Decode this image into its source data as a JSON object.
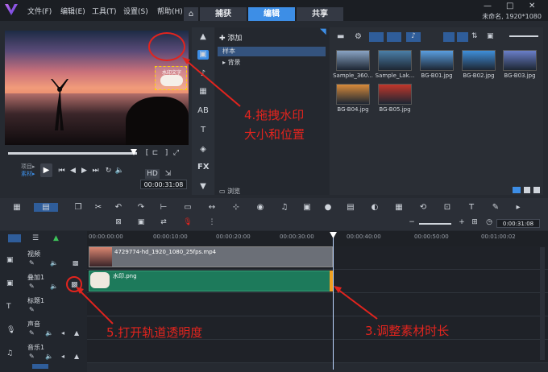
{
  "menu": {
    "file": "文件(F)",
    "edit": "编辑(E)",
    "tools": "工具(T)",
    "settings": "设置(S)",
    "help": "帮助(H)"
  },
  "tabs": {
    "capture": "捕获",
    "edit": "编辑",
    "share": "共享"
  },
  "status": "未命名, 1920*1080",
  "preview": {
    "watermark_text": "水印文字",
    "project_label": "项目▸",
    "clip_label": "素材▸",
    "timecode": "00:00:31:08"
  },
  "library": {
    "add_label": "添加",
    "folders": [
      "样本",
      "背景"
    ],
    "browse": "浏览",
    "thumbs": [
      {
        "label": "Sample_360...",
        "color": "#8aa4c4"
      },
      {
        "label": "Sample_Lak...",
        "color": "#4b7fa8"
      },
      {
        "label": "BG-B01.jpg",
        "color": "#5a9fe0"
      },
      {
        "label": "BG-B02.jpg",
        "color": "#3f8fd9"
      },
      {
        "label": "BG-B03.jpg",
        "color": "#6a7fc9"
      },
      {
        "label": "BG-B04.jpg",
        "color": "#d88b3a"
      },
      {
        "label": "BG-B05.jpg",
        "color": "#c2362a"
      }
    ]
  },
  "timeline": {
    "zoom_timecode": "0:00:31:08",
    "ruler": [
      "00:00:00:00",
      "00:00:10:00",
      "00:00:20:00",
      "00:00:30:00",
      "00:00:40:00",
      "00:00:50:00",
      "00:01:00:02"
    ],
    "tracks": [
      {
        "name": "视频"
      },
      {
        "name": "叠加1"
      },
      {
        "name": "标题1"
      },
      {
        "name": "声音"
      },
      {
        "name": "音乐1"
      }
    ],
    "video_clip": "4729774-hd_1920_1080_25fps.mp4",
    "overlay_clip": "水印.png"
  },
  "annotations": {
    "a4_line1": "4.拖拽水印",
    "a4_line2": "大小和位置",
    "a5": "5.打开轨道透明度",
    "a3": "3.调整素材时长"
  }
}
